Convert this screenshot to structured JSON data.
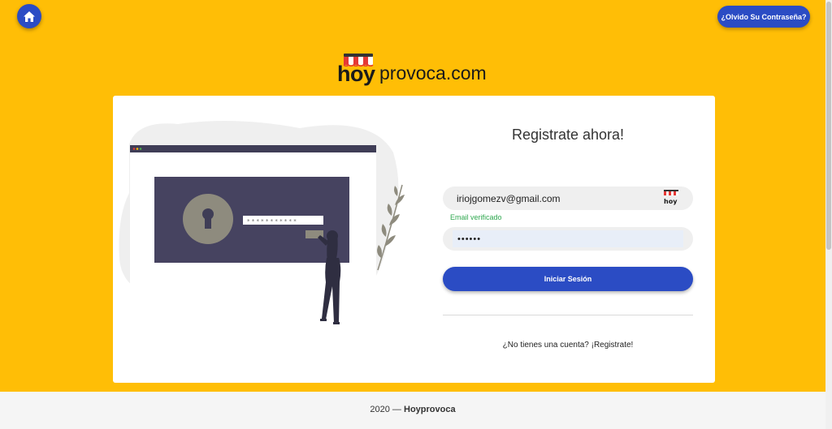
{
  "header": {
    "forgot_password_label": "¿Olvido Su Contraseña?"
  },
  "logo": {
    "hoy": "hoy",
    "rest": "provoca.com"
  },
  "form": {
    "heading": "Registrate ahora!",
    "email_value": "iriojgomezv@gmail.com",
    "email_status": "Email verificado",
    "password_value": "••••••",
    "login_label": "Iniciar Sesión",
    "register_text": "¿No tienes una cuenta? ¡Registrate!"
  },
  "footer": {
    "prefix": "2020 — ",
    "brand": "Hoyprovoca"
  },
  "colors": {
    "background": "#FFBE06",
    "primary": "#2B4CC4",
    "success": "#2FA84F"
  },
  "icons": {
    "home": "home-icon",
    "logo_mark": "store-awning-icon"
  }
}
